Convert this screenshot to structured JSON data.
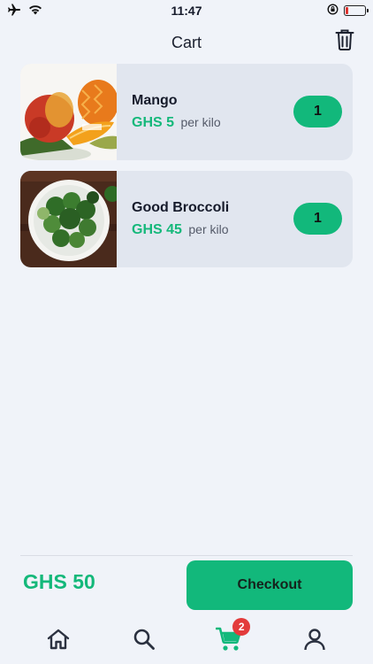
{
  "status_bar": {
    "time": "11:47",
    "icons": [
      "airplane-icon",
      "wifi-icon",
      "orientation-lock-icon",
      "battery-icon"
    ],
    "battery_color": "#e0342f",
    "battery_level": 0.15
  },
  "header": {
    "title": "Cart",
    "action_icon": "trash-icon"
  },
  "cart": {
    "items": [
      {
        "name": "Mango",
        "price": "GHS 5",
        "unit": "per kilo",
        "quantity": "1",
        "image": "mango-photo"
      },
      {
        "name": "Good Broccoli",
        "price": "GHS 45",
        "unit": "per kilo",
        "quantity": "1",
        "image": "broccoli-photo"
      }
    ]
  },
  "footer": {
    "total": "GHS 50",
    "checkout_label": "Checkout"
  },
  "tabbar": {
    "tabs": [
      {
        "icon": "home-icon",
        "active": false
      },
      {
        "icon": "search-icon",
        "active": false
      },
      {
        "icon": "cart-icon",
        "active": true,
        "badge": "2"
      },
      {
        "icon": "profile-icon",
        "active": false
      }
    ]
  },
  "colors": {
    "accent": "#12b87b",
    "price": "#14b87a",
    "badge": "#e33b3b",
    "card": "#e1e6ef",
    "background": "#f0f3f9"
  }
}
